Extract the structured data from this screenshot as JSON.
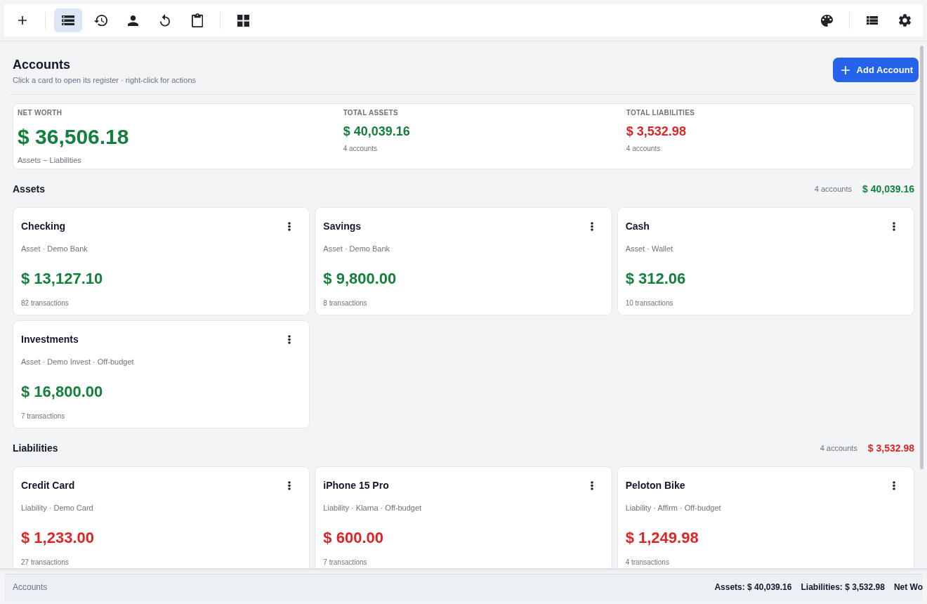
{
  "toolbar": {
    "left_groups": [
      [
        {
          "selected": false
        }
      ],
      [
        {
          "selected": true
        },
        {
          "selected": false
        },
        {
          "selected": false
        },
        {
          "selected": false
        },
        {
          "selected": false
        }
      ],
      [
        {
          "selected": false
        }
      ]
    ],
    "right_groups": [
      [
        {
          "selected": false
        }
      ],
      [
        {
          "selected": false
        },
        {
          "selected": false
        }
      ]
    ]
  },
  "header": {
    "title": "Accounts",
    "subtitle": "Click a card to open its register · right-click for actions",
    "add_button": {
      "label": "Add Account"
    }
  },
  "summary": [
    {
      "kind": "headline",
      "label": "NET WORTH",
      "value": "$ 36,506.18",
      "note": "Assets − Liabilities",
      "color": "#15803d"
    },
    {
      "kind": "total",
      "label": "TOTAL ASSETS",
      "value": "$ 40,039.16",
      "note": "4 accounts",
      "color": "#15803d"
    },
    {
      "kind": "total",
      "label": "TOTAL LIABILITIES",
      "value": "$ 3,532.98",
      "note": "4 accounts",
      "color": "#dc2626"
    }
  ],
  "sections": [
    {
      "title": "Assets",
      "count": "4 accounts",
      "total": "$ 40,039.16",
      "color": "#15803d",
      "accounts": [
        {
          "name": "Checking",
          "details": "Asset · Demo Bank",
          "balance": "$ 13,127.10",
          "transactions": "82 transactions"
        },
        {
          "name": "Savings",
          "details": "Asset · Demo Bank",
          "balance": "$ 9,800.00",
          "transactions": "8 transactions"
        },
        {
          "name": "Cash",
          "details": "Asset · Wallet",
          "balance": "$ 312.06",
          "transactions": "10 transactions"
        },
        {
          "name": "Investments",
          "details": "Asset · Demo Invest · Off-budget",
          "balance": "$ 16,800.00",
          "transactions": "7 transactions"
        }
      ]
    },
    {
      "title": "Liabilities",
      "count": "4 accounts",
      "total": "$ 3,532.98",
      "color": "#dc2626",
      "accounts": [
        {
          "name": "Credit Card",
          "details": "Liability · Demo Card",
          "balance": "$ 1,233.00",
          "transactions": "27 transactions"
        },
        {
          "name": "iPhone 15 Pro",
          "details": "Liability · Klarna · Off-budget",
          "balance": "$ 600.00",
          "transactions": "7 transactions"
        },
        {
          "name": "Peloton Bike",
          "details": "Liability · Affirm · Off-budget",
          "balance": "$ 1,249.98",
          "transactions": "4 transactions"
        }
      ]
    }
  ],
  "status_bar": {
    "left": "Accounts",
    "right": [
      "Assets: $ 40,039.16",
      "Liabilities: $ 3,532.98",
      "Net Wo"
    ]
  }
}
